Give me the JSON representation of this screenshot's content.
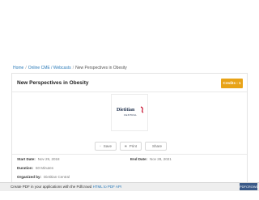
{
  "breadcrumb": {
    "items": [
      "Home",
      "Online CME / Webcasts",
      "New Perspectives in Obesity"
    ],
    "separator": "/"
  },
  "course": {
    "title": "New Perspectives in Obesity",
    "credits_label": "Credits : 1",
    "logo": {
      "name": "Dietitian",
      "sub": "CENTRAL"
    }
  },
  "actions": {
    "save": "Save",
    "print": "Print",
    "share": "Share"
  },
  "details": {
    "start_label": "Start Date:",
    "start_value": "Nov 29, 2018",
    "end_label": "End Date:",
    "end_value": "Nov 28, 2021",
    "duration_label": "Duration:",
    "duration_value": "60 Minutes",
    "organizer_label": "Organized by:",
    "organizer_value": "Dietitian Central"
  },
  "pdf_bar": {
    "text": "Create PDF in your applications with the Pdfcrowd",
    "link": "HTML to PDF API",
    "badge": "PDFCROWD"
  },
  "colors": {
    "accent": "#e8a317",
    "link": "#2a7ab8",
    "badge": "#3b5a88"
  }
}
